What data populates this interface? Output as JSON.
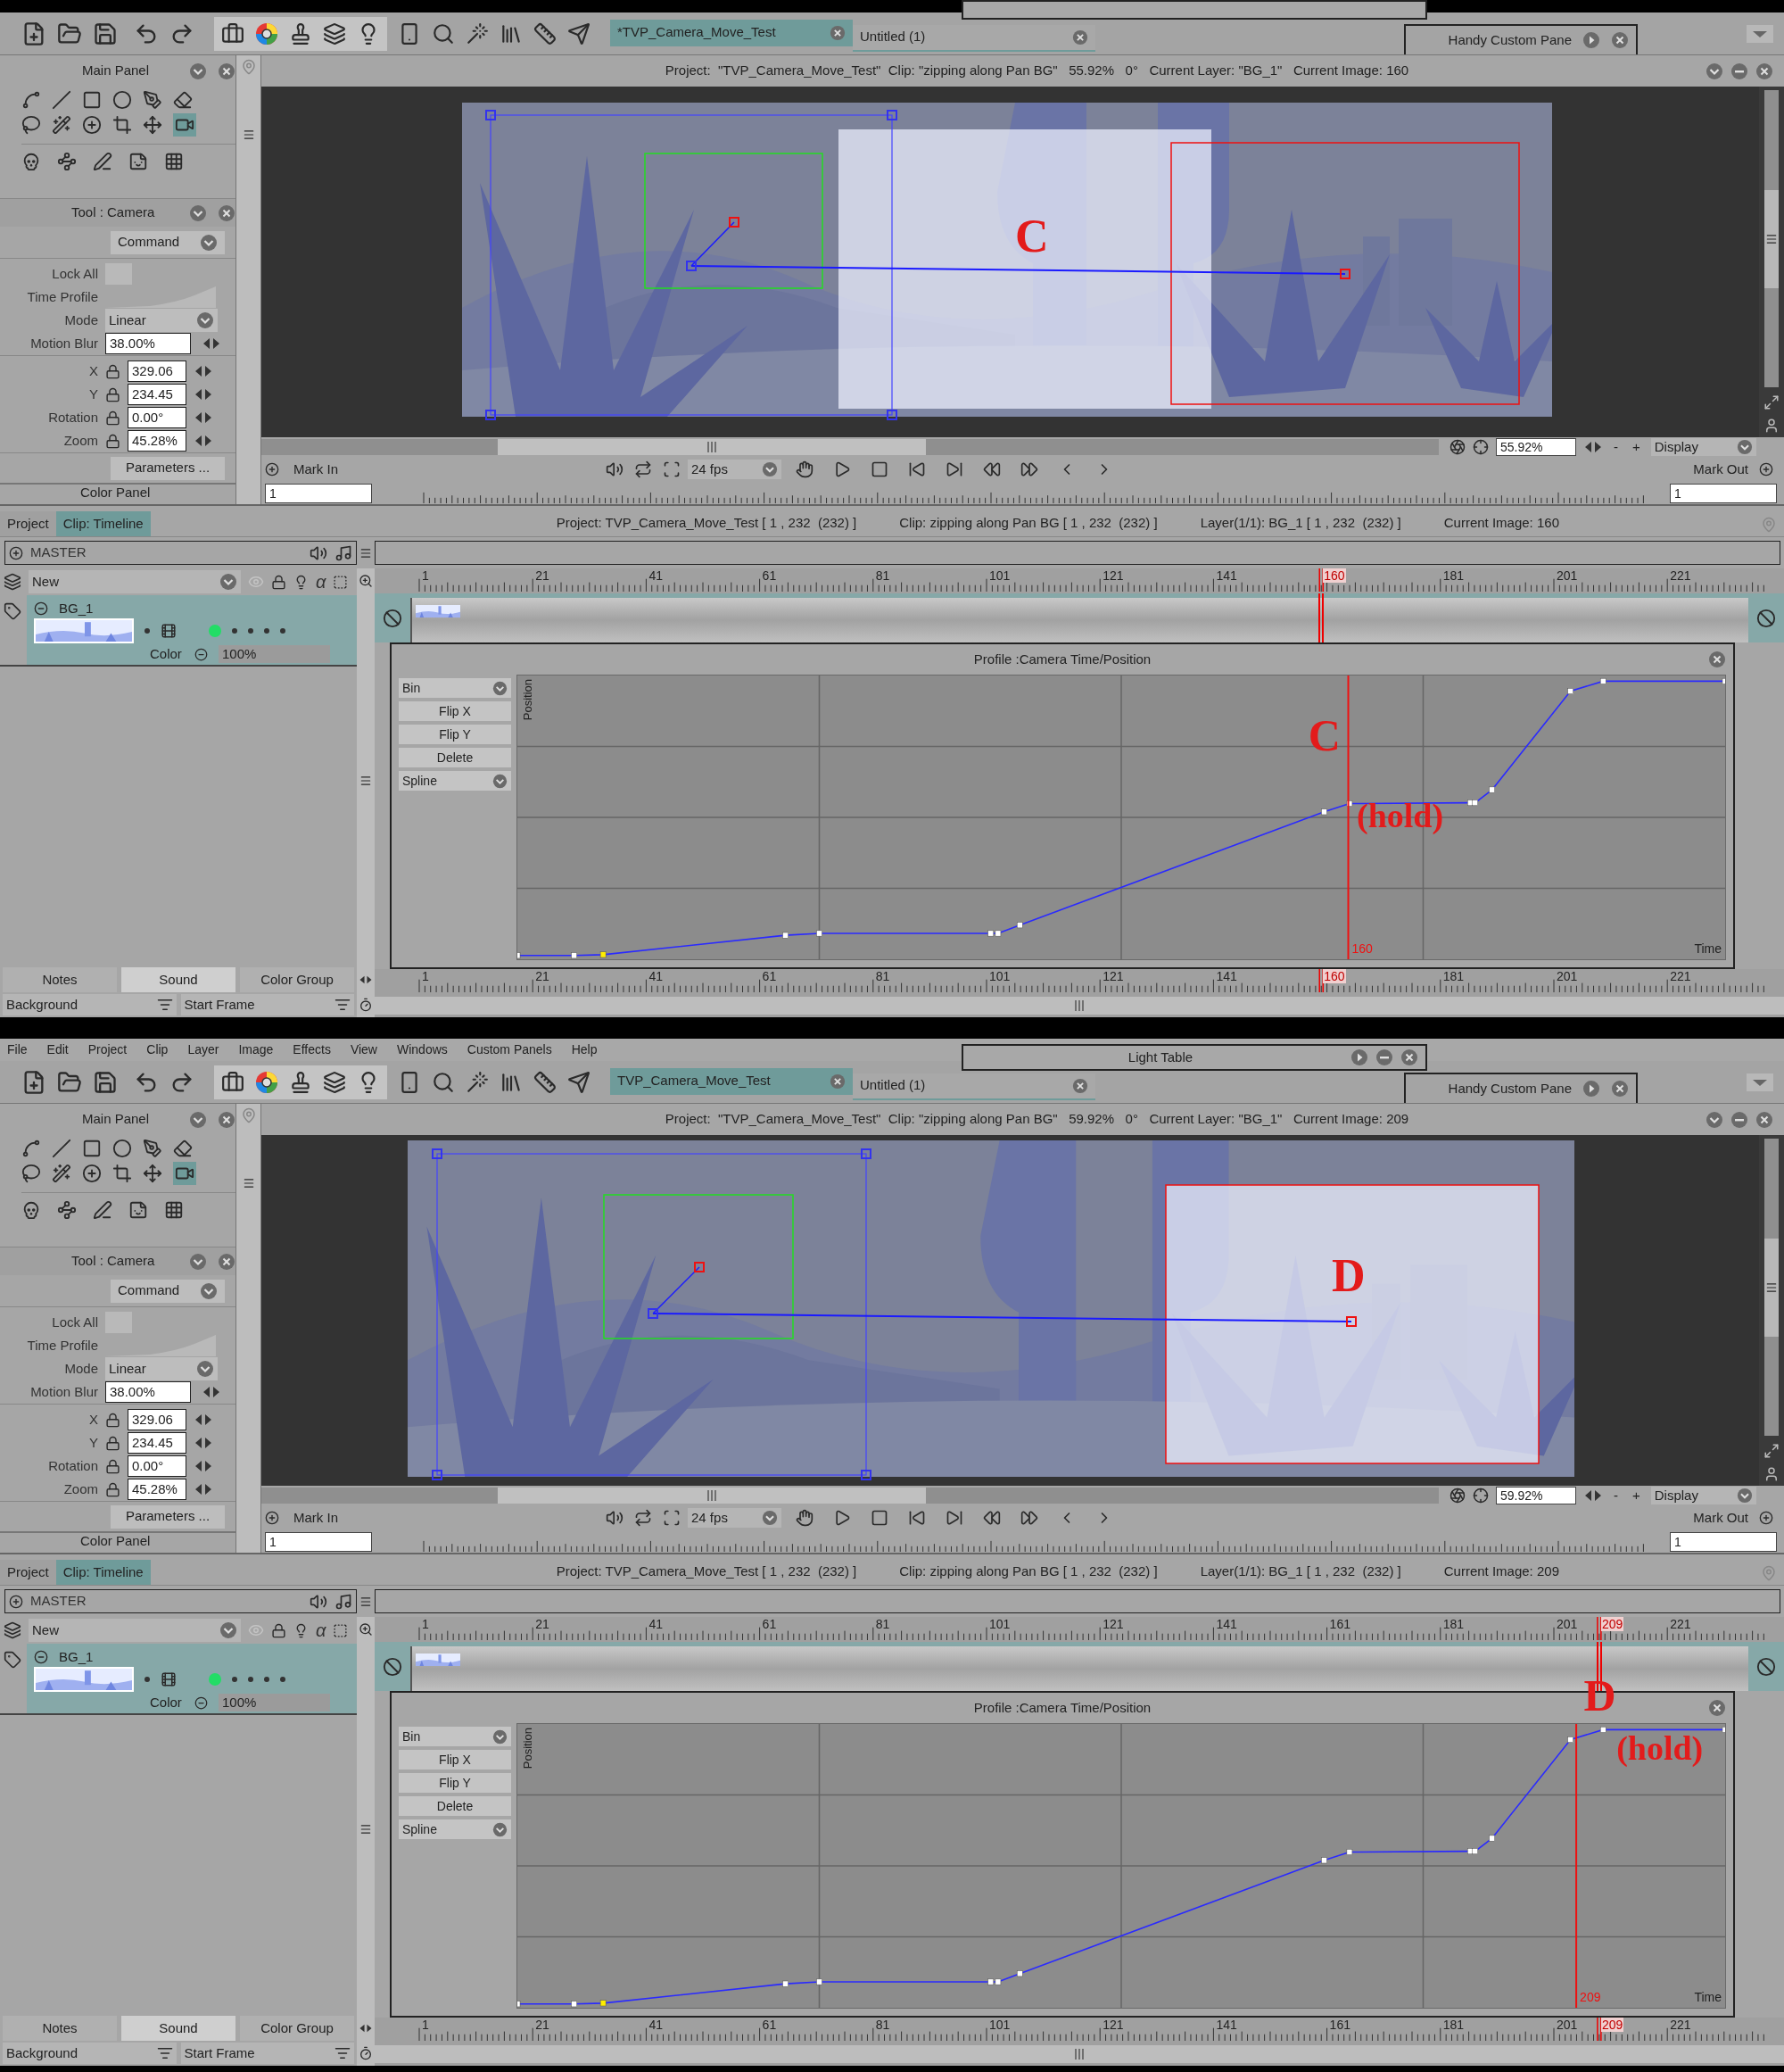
{
  "screens": [
    {
      "project_tabs": [
        {
          "label": "*TVP_Camera_Move_Test",
          "selected": true
        },
        {
          "label": "Untitled (1)",
          "selected": false
        }
      ],
      "handy_pane": "Handy Custom Pane",
      "main_panel": {
        "title": "Main Panel"
      },
      "tool_panel": {
        "title": "Tool : Camera",
        "command": "Command",
        "fields": [
          {
            "kind": "checkbox",
            "label": "Lock All",
            "checked": false
          },
          {
            "kind": "profile",
            "label": "Time Profile"
          },
          {
            "kind": "select",
            "label": "Mode",
            "value": "Linear"
          },
          {
            "kind": "number",
            "label": "Motion Blur",
            "value": "38.00%"
          },
          {
            "kind": "locked",
            "label": "X",
            "value": "329.06"
          },
          {
            "kind": "locked",
            "label": "Y",
            "value": "234.45"
          },
          {
            "kind": "locked",
            "label": "Rotation",
            "value": "0.00°"
          },
          {
            "kind": "locked",
            "label": "Zoom",
            "value": "45.28%"
          }
        ],
        "parameters": "Parameters ...",
        "next_panel": "Color Panel"
      },
      "viewer": {
        "header": "Project:  \"TVP_Camera_Move_Test\"  Clip: \"zipping along Pan BG\"   55.92%   0°   Current Layer: \"BG_1\"   Current Image: 160",
        "annotation": "C",
        "zoom": "55.92%",
        "minus": "-",
        "plus": "+",
        "display": "Display",
        "mark_in": "Mark In",
        "fps": "24 fps",
        "mark_out": "Mark Out",
        "mark_in_value": "1",
        "mark_out_value": "1"
      },
      "timeline": {
        "tabs": [
          {
            "label": "Project",
            "selected": false
          },
          {
            "label": "Clip: Timeline",
            "selected": true
          }
        ],
        "info": [
          "Project: TVP_Camera_Move_Test [ 1 , 232  (232) ]",
          "Clip: zipping along Pan BG [ 1 , 232  (232) ]",
          "Layer(1/1): BG_1 [ 1 , 232  (232) ]",
          "Current Image: 160"
        ],
        "master": "MASTER",
        "layer_preset": "New",
        "alpha_glyph": "α",
        "layer": {
          "name": "BG_1",
          "blend": "Color",
          "opacity": "100%"
        },
        "ruler": [
          {
            "label": "1",
            "current": false
          },
          {
            "label": "21",
            "current": false
          },
          {
            "label": "41",
            "current": false
          },
          {
            "label": "61",
            "current": false
          },
          {
            "label": "81",
            "current": false
          },
          {
            "label": "101",
            "current": false
          },
          {
            "label": "121",
            "current": false
          },
          {
            "label": "141",
            "current": false
          },
          {
            "label": "160",
            "current": true
          },
          {
            "label": "181",
            "current": false
          },
          {
            "label": "201",
            "current": false
          },
          {
            "label": "221",
            "current": false
          }
        ],
        "bottom_ruler": [
          {
            "label": "1",
            "current": false
          },
          {
            "label": "21",
            "current": false
          },
          {
            "label": "41",
            "current": false
          },
          {
            "label": "61",
            "current": false
          },
          {
            "label": "81",
            "current": false
          },
          {
            "label": "101",
            "current": false
          },
          {
            "label": "121",
            "current": false
          },
          {
            "label": "141",
            "current": false
          },
          {
            "label": "160",
            "current": true
          },
          {
            "label": "181",
            "current": false
          },
          {
            "label": "201",
            "current": false
          },
          {
            "label": "221",
            "current": false
          }
        ],
        "bottom_tabs": [
          {
            "label": "Notes",
            "selected": false
          },
          {
            "label": "Sound",
            "selected": true
          },
          {
            "label": "Color Group",
            "selected": false
          }
        ],
        "bottom_fields": [
          "Background",
          "Start Frame"
        ]
      },
      "profile": {
        "title": "Profile :Camera Time/Position",
        "buttons": [
          {
            "kind": "select",
            "label": "Bin"
          },
          {
            "kind": "button",
            "label": "Flip X"
          },
          {
            "kind": "button",
            "label": "Flip Y"
          },
          {
            "kind": "button",
            "label": "Delete"
          },
          {
            "kind": "select",
            "label": "Spline"
          }
        ],
        "ylabel": "Position",
        "xlabel": "Time",
        "current_frame": "160",
        "annotations": [
          "C",
          "(hold)"
        ]
      }
    },
    {
      "menu": [
        "File",
        "Edit",
        "Project",
        "Clip",
        "Layer",
        "Image",
        "Effects",
        "View",
        "Windows",
        "Custom Panels",
        "Help"
      ],
      "light_table": {
        "title": "Light Table"
      },
      "project_tabs": [
        {
          "label": "TVP_Camera_Move_Test",
          "selected": true
        },
        {
          "label": "Untitled (1)",
          "selected": false
        }
      ],
      "handy_pane": "Handy Custom Pane",
      "main_panel": {
        "title": "Main Panel"
      },
      "tool_panel": {
        "title": "Tool : Camera",
        "command": "Command",
        "fields": [
          {
            "kind": "checkbox",
            "label": "Lock All",
            "checked": false
          },
          {
            "kind": "profile",
            "label": "Time Profile"
          },
          {
            "kind": "select",
            "label": "Mode",
            "value": "Linear"
          },
          {
            "kind": "number",
            "label": "Motion Blur",
            "value": "38.00%"
          },
          {
            "kind": "locked",
            "label": "X",
            "value": "329.06"
          },
          {
            "kind": "locked",
            "label": "Y",
            "value": "234.45"
          },
          {
            "kind": "locked",
            "label": "Rotation",
            "value": "0.00°"
          },
          {
            "kind": "locked",
            "label": "Zoom",
            "value": "45.28%"
          }
        ],
        "parameters": "Parameters ...",
        "next_panel": "Color Panel"
      },
      "viewer": {
        "header": "Project:  \"TVP_Camera_Move_Test\"  Clip: \"zipping along Pan BG\"   59.92%   0°   Current Layer: \"BG_1\"   Current Image: 209",
        "annotation": "D",
        "zoom": "59.92%",
        "minus": "-",
        "plus": "+",
        "display": "Display",
        "mark_in": "Mark In",
        "fps": "24 fps",
        "mark_out": "Mark Out",
        "mark_in_value": "1",
        "mark_out_value": "1"
      },
      "timeline": {
        "tabs": [
          {
            "label": "Project",
            "selected": false
          },
          {
            "label": "Clip: Timeline",
            "selected": true
          }
        ],
        "info": [
          "Project: TVP_Camera_Move_Test [ 1 , 232  (232) ]",
          "Clip: zipping along Pan BG [ 1 , 232  (232) ]",
          "Layer(1/1): BG_1 [ 1 , 232  (232) ]",
          "Current Image: 209"
        ],
        "master": "MASTER",
        "layer_preset": "New",
        "alpha_glyph": "α",
        "layer": {
          "name": "BG_1",
          "blend": "Color",
          "opacity": "100%"
        },
        "ruler": [
          {
            "label": "1",
            "current": false
          },
          {
            "label": "21",
            "current": false
          },
          {
            "label": "41",
            "current": false
          },
          {
            "label": "61",
            "current": false
          },
          {
            "label": "81",
            "current": false
          },
          {
            "label": "101",
            "current": false
          },
          {
            "label": "121",
            "current": false
          },
          {
            "label": "141",
            "current": false
          },
          {
            "label": "161",
            "current": false
          },
          {
            "label": "181",
            "current": false
          },
          {
            "label": "201",
            "current": false
          },
          {
            "label": "209",
            "current": true
          },
          {
            "label": "221",
            "current": false
          }
        ],
        "bottom_ruler": [
          {
            "label": "1",
            "current": false
          },
          {
            "label": "21",
            "current": false
          },
          {
            "label": "41",
            "current": false
          },
          {
            "label": "61",
            "current": false
          },
          {
            "label": "81",
            "current": false
          },
          {
            "label": "101",
            "current": false
          },
          {
            "label": "121",
            "current": false
          },
          {
            "label": "141",
            "current": false
          },
          {
            "label": "161",
            "current": false
          },
          {
            "label": "181",
            "current": false
          },
          {
            "label": "201",
            "current": false
          },
          {
            "label": "209",
            "current": true
          },
          {
            "label": "221",
            "current": false
          }
        ],
        "bottom_tabs": [
          {
            "label": "Notes",
            "selected": false
          },
          {
            "label": "Sound",
            "selected": true
          },
          {
            "label": "Color Group",
            "selected": false
          }
        ],
        "bottom_fields": [
          "Background",
          "Start Frame"
        ]
      },
      "profile": {
        "title": "Profile :Camera Time/Position",
        "buttons": [
          {
            "kind": "select",
            "label": "Bin"
          },
          {
            "kind": "button",
            "label": "Flip X"
          },
          {
            "kind": "button",
            "label": "Flip Y"
          },
          {
            "kind": "button",
            "label": "Delete"
          },
          {
            "kind": "select",
            "label": "Spline"
          }
        ],
        "ylabel": "Position",
        "xlabel": "Time",
        "current_frame": "209",
        "annotations": [
          "D",
          "(hold)"
        ]
      }
    }
  ]
}
